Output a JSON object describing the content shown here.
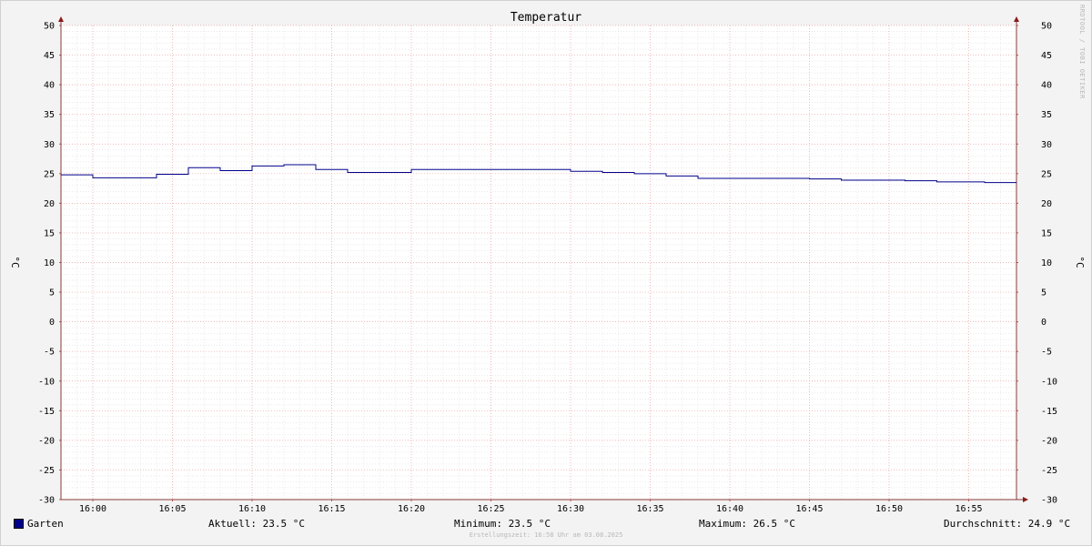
{
  "chart_data": {
    "type": "line",
    "title": "Temperatur",
    "ylabel": "°C",
    "ylim": [
      -30,
      50
    ],
    "yticks": [
      50,
      45,
      40,
      35,
      30,
      25,
      20,
      15,
      10,
      5,
      0,
      -5,
      -10,
      -15,
      -20,
      -25,
      -30
    ],
    "xlim": [
      "15:58",
      "16:58"
    ],
    "xtick_labels": [
      "16:00",
      "16:05",
      "16:10",
      "16:15",
      "16:20",
      "16:25",
      "16:30",
      "16:35",
      "16:40",
      "16:45",
      "16:50",
      "16:55"
    ],
    "grid": true,
    "series": [
      {
        "name": "Garten",
        "color": "#00008b",
        "step": true,
        "x": [
          "15:58",
          "16:00",
          "16:04",
          "16:06",
          "16:08",
          "16:10",
          "16:12",
          "16:14",
          "16:16",
          "16:20",
          "16:30",
          "16:32",
          "16:34",
          "16:36",
          "16:38",
          "16:45",
          "16:47",
          "16:51",
          "16:53",
          "16:56",
          "16:58"
        ],
        "values": [
          24.8,
          24.3,
          24.9,
          26.0,
          25.5,
          26.3,
          26.5,
          25.7,
          25.2,
          25.7,
          25.4,
          25.2,
          25.0,
          24.6,
          24.2,
          24.1,
          23.9,
          23.8,
          23.6,
          23.5,
          23.5
        ]
      }
    ]
  },
  "legend": {
    "series_name": "Garten",
    "aktuell": "Aktuell: 23.5 °C",
    "minimum": "Minimum: 23.5 °C",
    "maximum": "Maximum: 26.5 °C",
    "durchschnitt": "Durchschnitt: 24.9 °C"
  },
  "footer": {
    "created": "Erstellungszeit: 16:58 Uhr am 03.08.2025"
  },
  "watermark": "RRDTOOL / TOBI OETIKER"
}
